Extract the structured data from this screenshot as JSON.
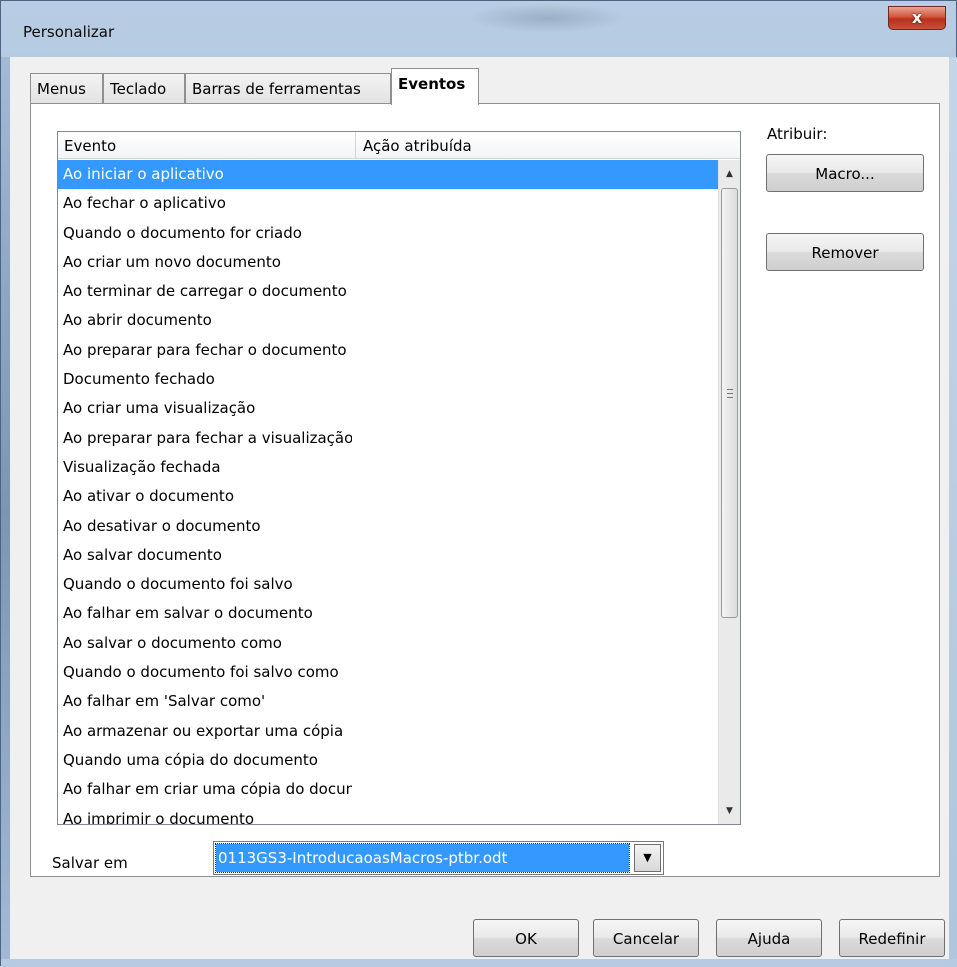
{
  "window": {
    "title": "Personalizar",
    "close_glyph": "x"
  },
  "tabs": [
    {
      "label": "Menus",
      "active": false
    },
    {
      "label": "Teclado",
      "active": false
    },
    {
      "label": "Barras de ferramentas",
      "active": false
    },
    {
      "label": "Eventos",
      "active": true
    }
  ],
  "events_list": {
    "columns": [
      "Evento",
      "Ação atribuída"
    ],
    "selected_index": 0,
    "rows": [
      "Ao iniciar o aplicativo",
      "Ao fechar o aplicativo",
      "Quando o documento for criado",
      "Ao criar um novo documento",
      "Ao terminar de carregar o documento",
      "Ao abrir documento",
      "Ao preparar para fechar o documento",
      "Documento fechado",
      "Ao criar uma visualização",
      "Ao preparar para fechar a visualização",
      "Visualização fechada",
      "Ao ativar o documento",
      "Ao desativar o documento",
      "Ao salvar documento",
      "Quando o documento foi salvo",
      "Ao falhar em salvar o documento",
      "Ao salvar o documento como",
      "Quando o documento foi salvo como",
      "Ao falhar em 'Salvar como'",
      "Ao armazenar ou exportar uma cópia",
      "Quando uma cópia do documento",
      "Ao falhar em criar uma cópia do documento",
      "Ao imprimir o documento"
    ]
  },
  "assign": {
    "label": "Atribuir:",
    "macro_button": "Macro...",
    "remove_button": "Remover"
  },
  "save_in": {
    "label": "Salvar em",
    "value": "0113GS3-IntroducaoasMacros-ptbr.odt"
  },
  "footer": {
    "ok": "OK",
    "cancel": "Cancelar",
    "help": "Ajuda",
    "reset": "Redefinir"
  }
}
